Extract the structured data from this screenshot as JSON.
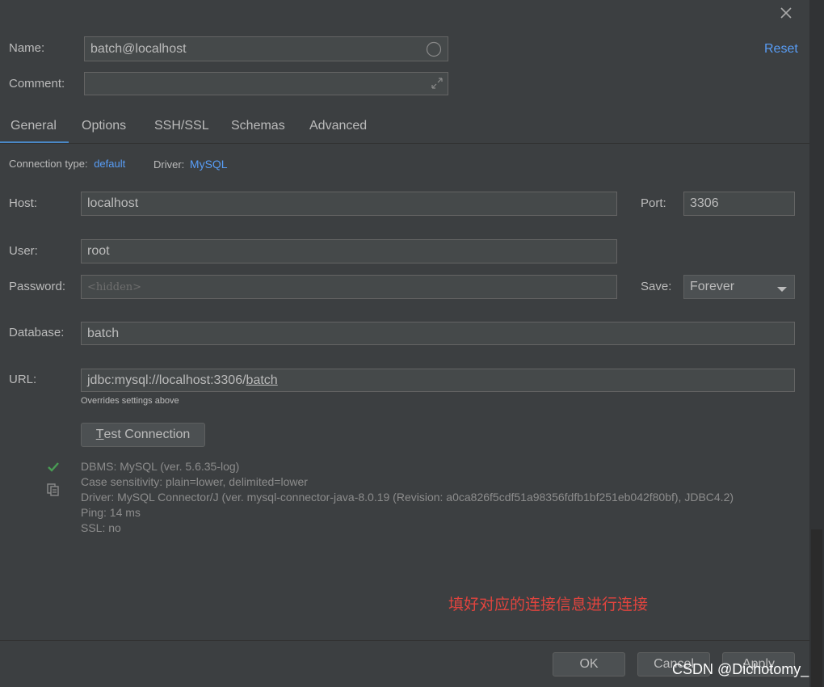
{
  "header": {
    "name_label": "Name:",
    "name_value": "batch@localhost",
    "comment_label": "Comment:",
    "comment_value": "",
    "reset_label": "Reset"
  },
  "tabs": [
    {
      "label": "General",
      "active": true
    },
    {
      "label": "Options",
      "active": false
    },
    {
      "label": "SSH/SSL",
      "active": false
    },
    {
      "label": "Schemas",
      "active": false
    },
    {
      "label": "Advanced",
      "active": false
    }
  ],
  "connection": {
    "type_label": "Connection type:",
    "type_value": "default",
    "driver_label": "Driver:",
    "driver_value": "MySQL"
  },
  "form": {
    "host_label": "Host:",
    "host_value": "localhost",
    "port_label": "Port:",
    "port_value": "3306",
    "user_label": "User:",
    "user_value": "root",
    "password_label": "Password:",
    "password_placeholder": "<hidden>",
    "save_label": "Save:",
    "save_value": "Forever",
    "database_label": "Database:",
    "database_value": "batch",
    "url_label": "URL:",
    "url_prefix": "jdbc:mysql://localhost:3306/",
    "url_db": "batch",
    "url_hint": "Overrides settings above"
  },
  "test": {
    "button_rest": "est Connection",
    "button_mnemonic": "T",
    "lines": [
      "DBMS: MySQL (ver. 5.6.35-log)",
      "Case sensitivity: plain=lower, delimited=lower",
      "Driver: MySQL Connector/J (ver. mysql-connector-java-8.0.19 (Revision: a0ca826f5cdf51a98356fdfb1bf251eb042f80bf), JDBC4.2)",
      "Ping: 14 ms",
      "SSL: no"
    ]
  },
  "annotation": "填好对应的连接信息进行连接",
  "footer": {
    "ok_label": "OK",
    "cancel_label": "Cancel",
    "apply_label": "Apply"
  },
  "watermark": "CSDN @Dichotomy_",
  "colors": {
    "background": "#3c3f41",
    "accent": "#589df6",
    "success": "#499c54",
    "annotation": "#e0443e"
  },
  "icons": [
    "close-icon",
    "circle-icon",
    "expand-icon",
    "dropdown-arrow-icon",
    "check-icon",
    "copy-icon"
  ]
}
